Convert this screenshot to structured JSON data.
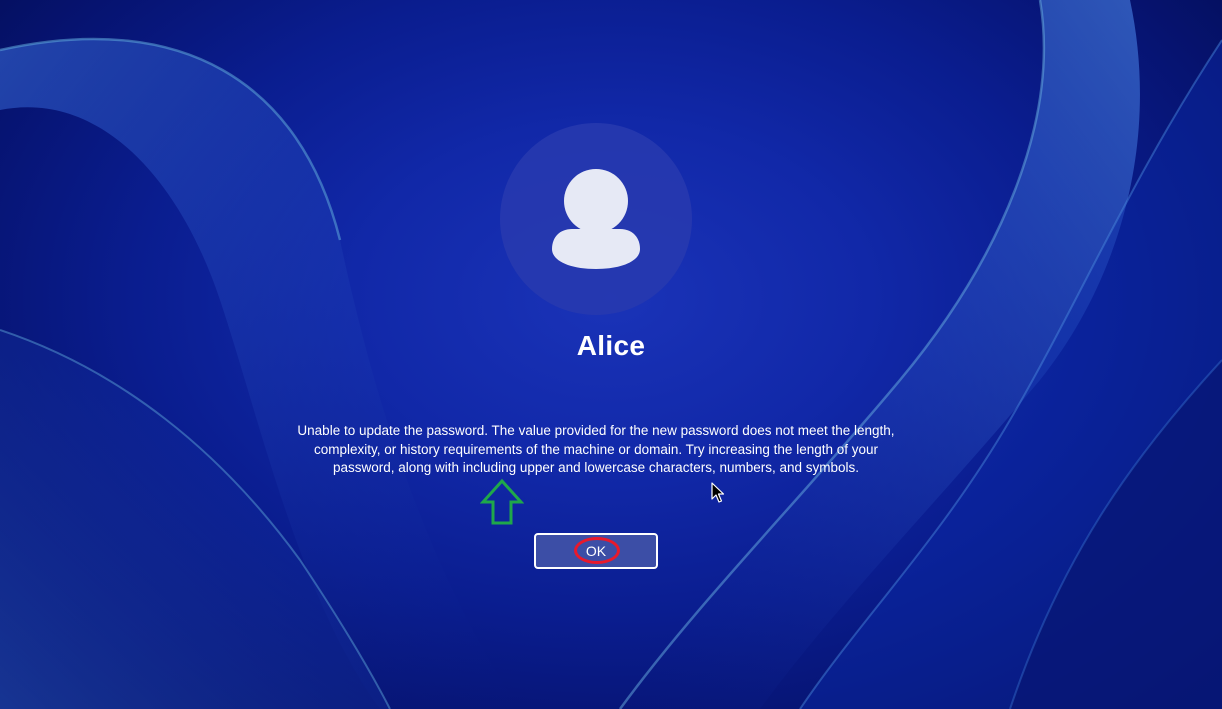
{
  "user": {
    "name": "Alice",
    "avatar_icon": "user-silhouette-icon"
  },
  "dialog": {
    "message": "Unable to update the password. The value provided for the new password does not meet the length, complexity, or history requirements of the machine or domain. Try increasing the length of your password, along with including upper and lowercase characters, numbers, and symbols.",
    "ok_label": "OK"
  },
  "annotations": {
    "arrow_icon": "up-arrow-icon",
    "arrow_color": "#1fa84a",
    "highlight_color": "#e8192c"
  },
  "colors": {
    "background": "#0a1d8f",
    "button_bg": "#3c4ea6",
    "text": "#ffffff"
  }
}
